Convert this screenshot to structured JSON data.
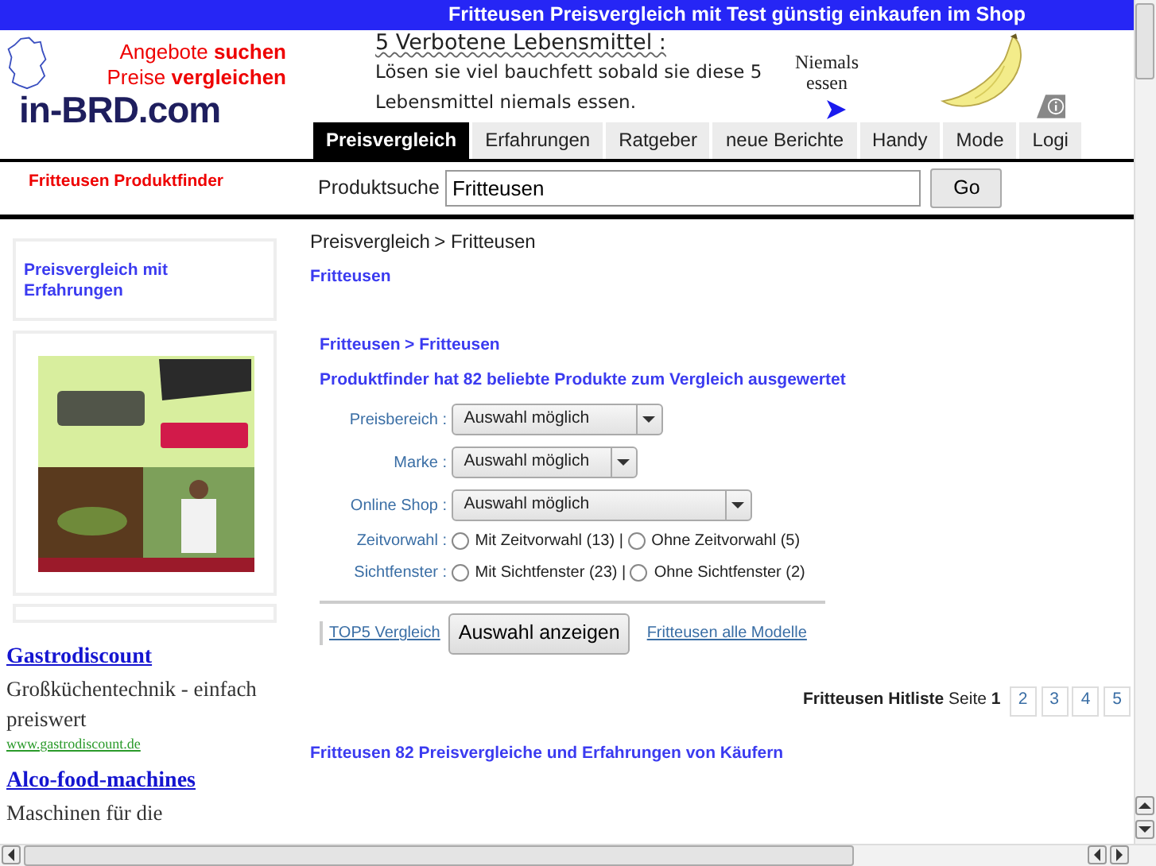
{
  "top_bar": {
    "title": "Fritteusen Preisvergleich mit Test günstig einkaufen im Shop"
  },
  "logo": {
    "line_1": "Angebote **suchen**",
    "line_2": "Preise **vergleichen**",
    "brand": "in-BRD.com"
  },
  "ad_banner": {
    "heading": "5 Verbotene Lebensmittel :",
    "text": "Lösen sie viel bauchfett sobald sie diese 5 Lebensmittel niemals essen.",
    "side_text": "Niemals essen"
  },
  "nav_tabs": [
    {
      "label": "Preisvergleich",
      "selected": true
    },
    {
      "label": "Erfahrungen",
      "selected": false
    },
    {
      "label": "Ratgeber",
      "selected": false
    },
    {
      "label": "neue Berichte",
      "selected": false
    },
    {
      "label": "Handy",
      "selected": false
    },
    {
      "label": "Mode",
      "selected": false
    },
    {
      "label": "Logi",
      "selected": false
    }
  ],
  "finder_title": "Fritteusen Produktfinder",
  "search": {
    "label": "Produktsuche",
    "value": "Fritteusen",
    "button": "Go"
  },
  "sidebar": {
    "box_link": "Preisvergleich mit Erfahrungen",
    "text_ads": [
      {
        "title": "Gastrodiscount",
        "text": "Großküchentechnik - einfach preiswert",
        "url": "www.gastrodiscount.de"
      },
      {
        "title": "Alco-food-machines",
        "text": "Maschinen für die"
      }
    ]
  },
  "breadcrumb": {
    "link": "Preisvergleich",
    "current": "> Fritteusen"
  },
  "heading": "Fritteusen",
  "finder": {
    "breadcrumb_link": "Fritteusen",
    "breadcrumb_current": "> Fritteusen",
    "summary": "Produktfinder hat 82 beliebte Produkte zum Vergleich ausgewertet",
    "filters": [
      {
        "kind": "select",
        "label": "Preisbereich",
        "colon": ":",
        "value": "Auswahl möglich"
      },
      {
        "kind": "select",
        "label": "Marke",
        "colon": ":",
        "value": "Auswahl möglich"
      },
      {
        "kind": "select",
        "label": "Online Shop",
        "colon": ":",
        "value": "Auswahl möglich"
      },
      {
        "kind": "radio",
        "label": "Zeitvorwahl",
        "colon": ":",
        "separator": "|",
        "options": [
          {
            "label": "Mit Zeitvorwahl (13)",
            "selected": false
          },
          {
            "label": "Ohne Zeitvorwahl (5)",
            "selected": false
          }
        ]
      },
      {
        "kind": "radio",
        "label": "Sichtfenster",
        "colon": ":",
        "separator": "|",
        "options": [
          {
            "label": "Mit Sichtfenster (23)",
            "selected": false
          },
          {
            "label": "Ohne Sichtfenster (2)",
            "selected": false
          }
        ]
      }
    ],
    "top5_link": "TOP5 Vergleich",
    "show_button": "Auswahl anzeigen",
    "all_models_link": "Fritteusen alle Modelle"
  },
  "hitlist": {
    "title": "Fritteusen Hitliste",
    "page_label": "Seite",
    "current_page": "1",
    "pages": [
      "2",
      "3",
      "4",
      "5"
    ]
  },
  "footer_heading": "Fritteusen 82 Preisvergleiche und Erfahrungen von Käufern"
}
